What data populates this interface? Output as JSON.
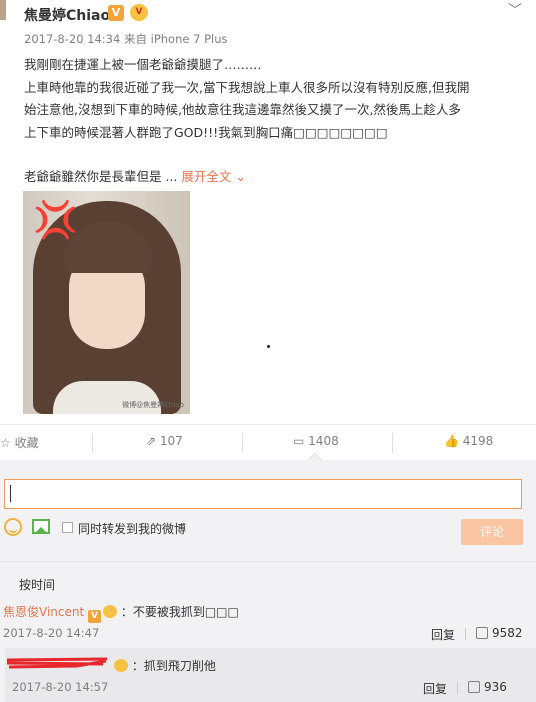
{
  "post": {
    "username": "焦曼婷Chiao",
    "verified_badge": "V",
    "meta": "2017-8-20 14:34 来自 iPhone 7 Plus",
    "lines": [
      "我剛剛在捷運上被一個老爺爺摸腿了………",
      "上車時他靠的我很近碰了我一次,當下我想說上車人很多所以沒有特別反應,但我開",
      "始注意他,沒想到下車的時候,他故意往我這邊靠然後又摸了一次,然後馬上趁人多",
      "上下車的時候混著人群跑了GOD!!!我氣到胸口痛□□□□□□□□",
      "老爺爺雖然你是長輩但是 ..."
    ],
    "expand_label": "展开全文",
    "expand_icon": "chevron-down-icon",
    "photo_watermark": "微博@焦曼婷Chiao",
    "photo_emoji": "anger-symbol"
  },
  "actions": {
    "favorite": "收藏",
    "repost": "107",
    "comment": "1408",
    "like": "4198"
  },
  "composer": {
    "input_value": "",
    "sync_label": "同时转发到我的微博",
    "submit_label": "评论"
  },
  "comments_header": {
    "sort_label": "按时间"
  },
  "comments": [
    {
      "name": "焦恩俊Vincent",
      "text": "：不要被我抓到□□□",
      "time": "2017-8-20 14:47",
      "reply_label": "回复",
      "likes": "9582"
    },
    {
      "name": "",
      "text": "：抓到飛刀削他",
      "time": "2017-8-20 14:57",
      "reply_label": "回复",
      "likes": "936"
    }
  ],
  "colors": {
    "accent": "#eb7350",
    "input_border": "#f09a58",
    "submit_bg": "#fbc4a2",
    "panel_bg": "#f2f2f5",
    "redaction": "#e8262b"
  }
}
